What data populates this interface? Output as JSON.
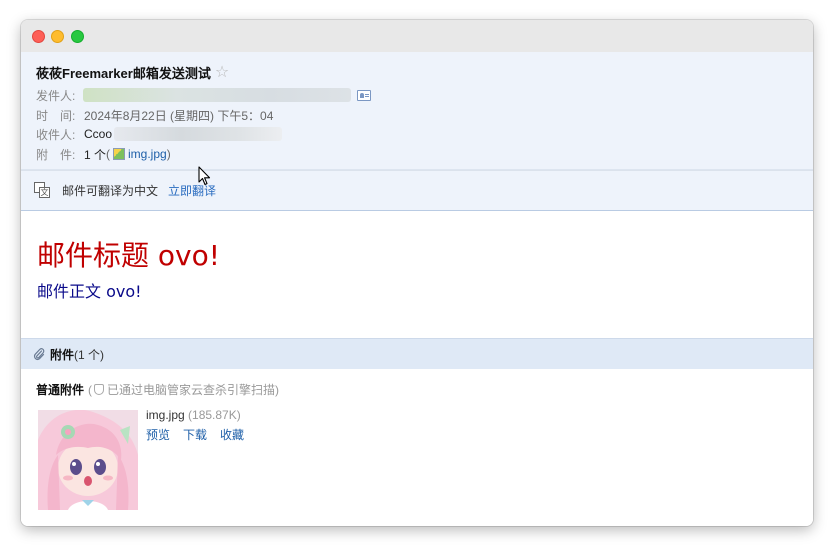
{
  "email": {
    "subject": "莜莜Freemarker邮箱发送测试",
    "star_icon": "star-outline-icon",
    "sender_label": "发件人:",
    "time_label": "时　间:",
    "time_value": "2024年8月22日 (星期四) 下午5：04",
    "recipient_label": "收件人:",
    "recipient_value": "Ccoo",
    "attachment_label": "附　件:",
    "attachment_count": "1 个",
    "attachment_paren_open": " (",
    "attachment_name": "img.jpg",
    "attachment_paren_close": ")"
  },
  "translate": {
    "text": "邮件可翻译为中文",
    "link": "立即翻译",
    "icon": "translate-icon"
  },
  "body": {
    "title": "邮件标题 ovo!",
    "content": "邮件正文 ovo!"
  },
  "attachments": {
    "bar_title": "附件",
    "bar_count": "(1 个)",
    "normal_label": "普通附件",
    "scan_note_open": "(",
    "scan_note": "已通过电脑管家云查杀引擎扫描)",
    "file": {
      "name": "img.jpg",
      "size": "(185.87K)",
      "actions": [
        "预览",
        "下载",
        "收藏"
      ]
    }
  },
  "colors": {
    "title_red": "#c00000",
    "content_blue": "#0a0a8a",
    "link_blue": "#1e5fa8",
    "header_bg": "#eef3fb",
    "attach_bar_bg": "#dfe9f6"
  }
}
